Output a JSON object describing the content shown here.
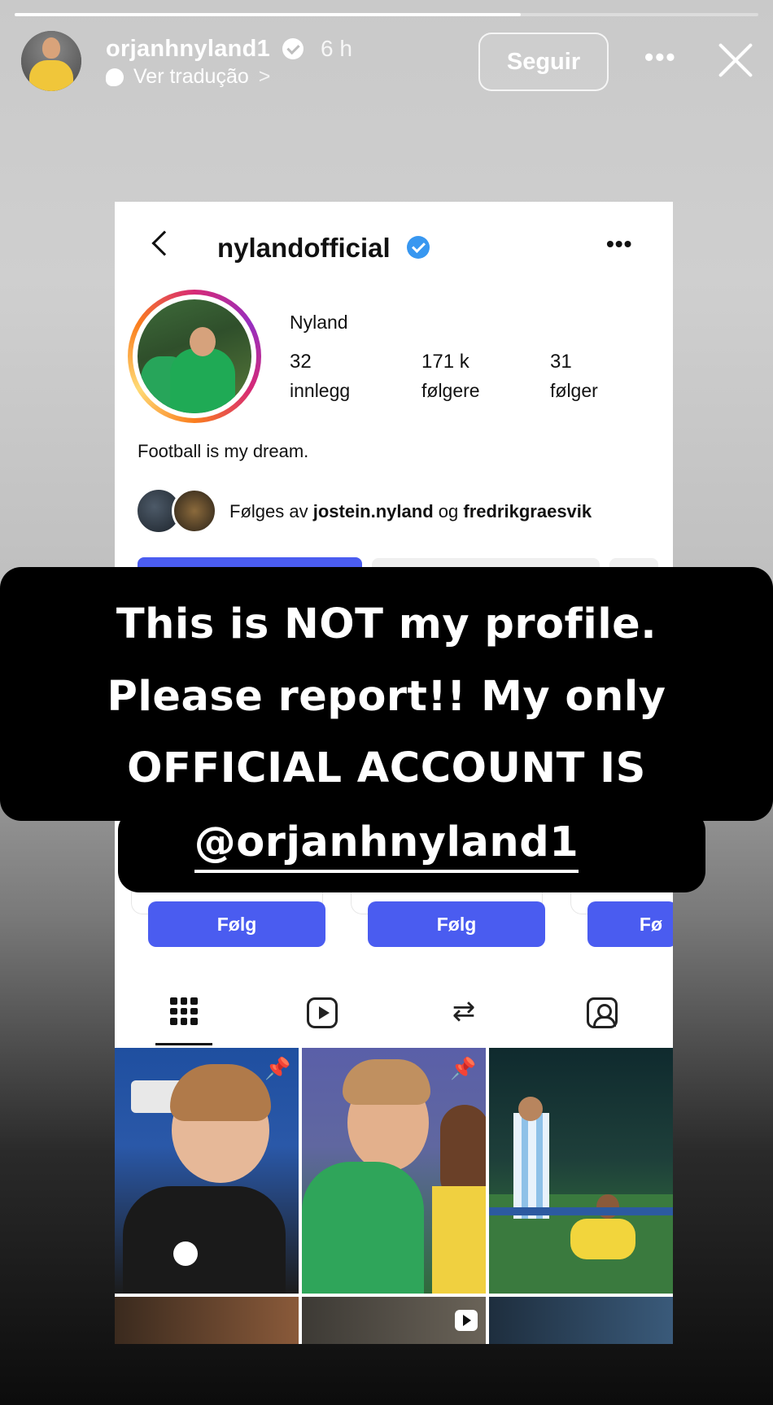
{
  "story": {
    "progress": 0.68,
    "username": "orjanhnyland1",
    "time": "6 h",
    "translate_label": "Ver tradução",
    "translate_chevron": ">",
    "follow_label": "Seguir",
    "more_label": "•••"
  },
  "profile": {
    "username": "nylandofficial",
    "more_label": "•••",
    "display_name": "Nyland",
    "stats": [
      {
        "value": "32",
        "label": "innlegg"
      },
      {
        "value": "171 k",
        "label": "følgere"
      },
      {
        "value": "31",
        "label": "følger"
      }
    ],
    "bio": "Football is my dream.",
    "followed_by": {
      "prefix": "Følges av",
      "user1": "jostein.nyland",
      "joiner": "og",
      "user2": "fredrikgraesvik"
    },
    "suggested_follow_label": "Følg",
    "suggested_follow_partial": "Fø",
    "tabs": [
      "grid-icon",
      "reels-icon",
      "repost-icon",
      "tagged-icon"
    ]
  },
  "overlay": {
    "line1": "This is NOT my profile.",
    "line2": "Please report!! My only",
    "line3": "OFFICIAL ACCOUNT IS",
    "line4": "@orjanhnyland1"
  },
  "colors": {
    "follow_blue": "#4a5cf0",
    "verified_blue": "#3897f0"
  }
}
